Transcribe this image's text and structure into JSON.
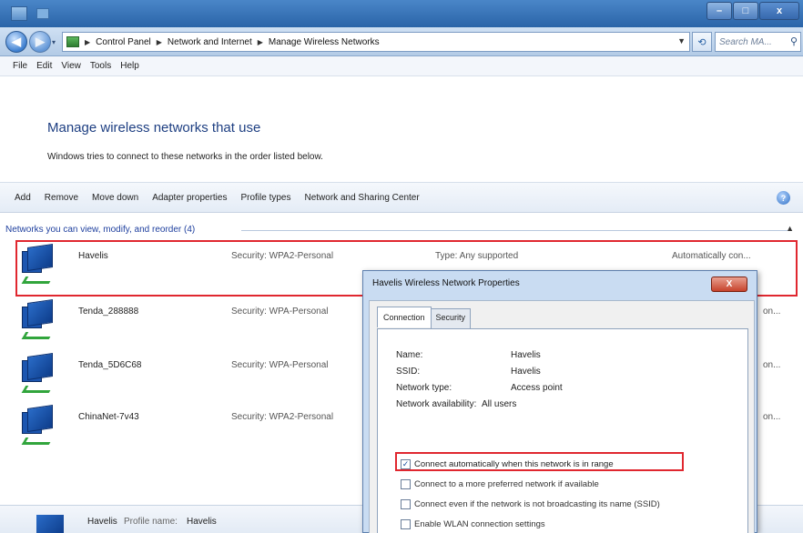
{
  "window": {
    "buttons": {
      "minimize": "–",
      "maximize": "□",
      "close": "x"
    }
  },
  "address": {
    "crumbs": [
      "Control Panel",
      "Network and Internet",
      "Manage Wireless Networks"
    ],
    "search_placeholder": "Search MA..."
  },
  "menu": {
    "items": [
      "File",
      "Edit",
      "View",
      "Tools",
      "Help"
    ]
  },
  "header": {
    "title": "Manage wireless networks that use",
    "subtitle": "Windows tries to connect to these networks in the order listed below."
  },
  "toolbar": {
    "items": [
      "Add",
      "Remove",
      "Move down",
      "Adapter properties",
      "Profile types",
      "Network and Sharing Center"
    ],
    "help_glyph": "?"
  },
  "group": {
    "label": "Networks you can view, modify, and reorder (4)"
  },
  "networks": [
    {
      "name": "Havelis",
      "security": "Security: WPA2-Personal",
      "type": "Type: Any supported",
      "auto": "Automatically con..."
    },
    {
      "name": "Tenda_288888",
      "security": "Security: WPA-Personal",
      "auto": "on..."
    },
    {
      "name": "Tenda_5D6C68",
      "security": "Security: WPA-Personal",
      "auto": "on..."
    },
    {
      "name": "ChinaNet-7v43",
      "security": "Security: WPA2-Personal",
      "auto": "on..."
    }
  ],
  "details": {
    "name": "Havelis",
    "label": "Profile name:",
    "value": "Havelis"
  },
  "dialog": {
    "title": "Havelis Wireless Network Properties",
    "close_label": "X",
    "tabs": [
      "Connection",
      "Security"
    ],
    "props": [
      {
        "label": "Name:",
        "value": "Havelis"
      },
      {
        "label": "SSID:",
        "value": "Havelis"
      },
      {
        "label": "Network type:",
        "value": "Access point"
      },
      {
        "label": "Network availability:",
        "value": "All users"
      }
    ],
    "checkboxes": [
      {
        "label": "Connect automatically when this network is in range",
        "checked": true
      },
      {
        "label": "Connect to a more preferred network if available",
        "checked": false
      },
      {
        "label": "Connect even if the network is not broadcasting its name (SSID)",
        "checked": false
      },
      {
        "label": "Enable WLAN connection settings",
        "checked": false
      }
    ]
  },
  "colors": {
    "highlight": "#e0272f",
    "link": "#1e3f82"
  }
}
